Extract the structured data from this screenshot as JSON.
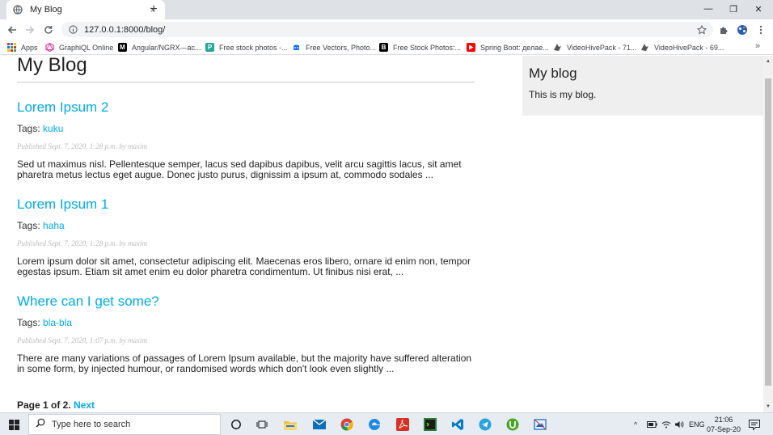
{
  "browser": {
    "tab_title": "My Blog",
    "tab_close": "×",
    "new_tab": "+",
    "url": "127.0.0.1:8000/blog/",
    "window_controls": [
      "—",
      "❐",
      "✕"
    ]
  },
  "bookmarks": {
    "items": [
      {
        "label": "Apps",
        "icon": "apps-grid-icon",
        "color": "#4285f4"
      },
      {
        "label": "GraphiQL Online",
        "icon": "graphql-icon",
        "color": "#e535ab"
      },
      {
        "label": "Angular/NGRX—ас...",
        "icon": "medium-icon",
        "color": "#000000"
      },
      {
        "label": "Free stock photos -...",
        "icon": "photo-icon",
        "color": "#26a69a"
      },
      {
        "label": "Free Vectors, Photo...",
        "icon": "freepik-icon",
        "color": "#1273eb"
      },
      {
        "label": "Free Stock Photos:...",
        "icon": "b-icon",
        "color": "#000000"
      },
      {
        "label": "Spring Boot: делае...",
        "icon": "youtube-icon",
        "color": "#ff0000"
      },
      {
        "label": "VideoHivePack - 71...",
        "icon": "videohive-icon",
        "color": "#555555"
      },
      {
        "label": "VideoHivePack - 69...",
        "icon": "videohive-icon",
        "color": "#555555"
      }
    ],
    "more": "»"
  },
  "page": {
    "title": "My Blog",
    "posts": [
      {
        "title": "Lorem Ipsum 2",
        "tags_label": "Tags:",
        "tag": "kuku",
        "date": "Published Sept. 7, 2020, 1:28 p.m. by maxim",
        "excerpt": "Sed ut maximus nisl. Pellentesque semper, lacus sed dapibus dapibus, velit arcu sagittis lacus, sit amet pharetra metus lectus eget augue. Donec justo purus, dignissim a ipsum at, commodo sodales ..."
      },
      {
        "title": "Lorem Ipsum 1",
        "tags_label": "Tags:",
        "tag": "haha",
        "date": "Published Sept. 7, 2020, 1:28 p.m. by maxim",
        "excerpt": "Lorem ipsum dolor sit amet, consectetur adipiscing elit. Maecenas eros libero, ornare id enim non, tempor egestas ipsum. Etiam sit amet enim eu dolor pharetra condimentum. Ut finibus nisi erat, ..."
      },
      {
        "title": "Where can I get some?",
        "tags_label": "Tags:",
        "tag": "bla-bla",
        "date": "Published Sept. 7, 2020, 1:07 p.m. by maxim",
        "excerpt": "There are many variations of passages of Lorem Ipsum available, but the majority have suffered alteration in some form, by injected humour, or randomised words which don't look even slightly ..."
      }
    ],
    "pagination": {
      "status": "Page 1 of 2.",
      "next": "Next"
    }
  },
  "sidebar": {
    "title": "My blog",
    "text": "This is my blog."
  },
  "taskbar": {
    "search_placeholder": "Type here to search",
    "language": "ENG",
    "time": "21:06",
    "date": "07-Sep-20"
  },
  "colors": {
    "link": "#00abeb",
    "sidebar_bg": "#efefef"
  }
}
